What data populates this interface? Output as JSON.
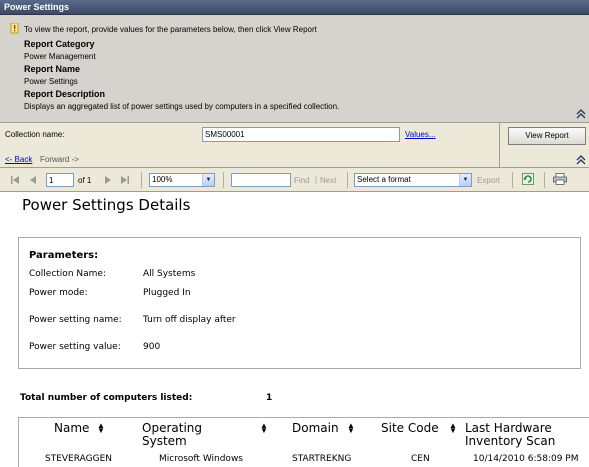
{
  "window": {
    "title": "Power Settings"
  },
  "parameters_panel": {
    "instruction": "To view the report, provide values for the parameters below, then click View Report",
    "report_category_label": "Report Category",
    "report_category_value": "Power Management",
    "report_name_label": "Report Name",
    "report_name_value": "Power Settings",
    "report_description_label": "Report Description",
    "report_description_value": "Displays an aggregated list of power settings used by computers in a specified collection."
  },
  "collection": {
    "label": "Collection name:",
    "value": "SMS00001",
    "values_link": "Values...",
    "view_report_button": "View Report",
    "back_link": "<- Back",
    "forward_link": "Forward ->"
  },
  "toolbar": {
    "page_value": "1",
    "page_of": "of 1",
    "zoom_value": "100%",
    "find_placeholder": "",
    "find_label": "Find",
    "separator": "|",
    "next_label": "Next",
    "format_value": "Select a format",
    "export_label": "Export"
  },
  "report": {
    "title": "Power Settings Details",
    "params_heading": "Parameters:",
    "params": [
      {
        "key": "Collection Name:",
        "value": "All Systems"
      },
      {
        "key": "Power mode:",
        "value": "Plugged In"
      },
      {
        "key": "Power setting name:",
        "value": "Turn off display after"
      },
      {
        "key": "Power setting value:",
        "value": "900"
      }
    ],
    "total_label": "Total number of computers listed:",
    "total_value": "1",
    "table": {
      "columns": [
        "Name",
        "Operating System",
        "Domain",
        "Site Code",
        "Last Hardware Inventory Scan"
      ],
      "rows": [
        [
          "STEVERAGGEN",
          "Microsoft Windows",
          "STARTREKNG",
          "CEN",
          "10/14/2010 6:58:09 PM"
        ]
      ]
    }
  },
  "colors": {
    "panel_bg": "#d6d3ce",
    "toolbar_bg": "#ece9d8",
    "link": "#0000cc",
    "title_bar": "#3c4a66"
  }
}
